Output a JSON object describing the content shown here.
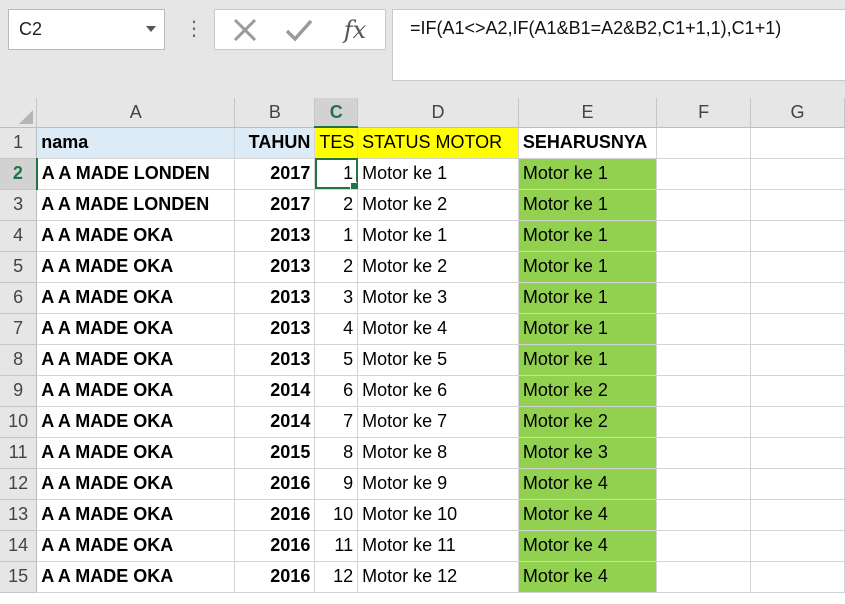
{
  "name_box": {
    "value": "C2"
  },
  "formula_bar": {
    "fx_label": "fx",
    "formula": "=IF(A1<>A2,IF(A1&B1=A2&B2,C1+1,1),C1+1)"
  },
  "columns": [
    "A",
    "B",
    "C",
    "D",
    "E",
    "F",
    "G"
  ],
  "selected_column": "C",
  "selected_row": "2",
  "header_row": {
    "row_number": "1",
    "cells": [
      "nama",
      "TAHUN",
      "TES",
      "STATUS MOTOR",
      "SEHARUSNYA",
      "",
      ""
    ]
  },
  "rows": [
    {
      "row_number": "2",
      "nama": "A A MADE LONDEN",
      "tahun": "2017",
      "tes": "1",
      "status": "Motor ke 1",
      "seharusnya": "Motor ke 1"
    },
    {
      "row_number": "3",
      "nama": "A A MADE LONDEN",
      "tahun": "2017",
      "tes": "2",
      "status": "Motor ke 2",
      "seharusnya": "Motor ke 1"
    },
    {
      "row_number": "4",
      "nama": "A A MADE OKA",
      "tahun": "2013",
      "tes": "1",
      "status": "Motor ke 1",
      "seharusnya": "Motor ke 1"
    },
    {
      "row_number": "5",
      "nama": "A A MADE OKA",
      "tahun": "2013",
      "tes": "2",
      "status": "Motor ke 2",
      "seharusnya": "Motor ke 1"
    },
    {
      "row_number": "6",
      "nama": "A A MADE OKA",
      "tahun": "2013",
      "tes": "3",
      "status": "Motor ke 3",
      "seharusnya": "Motor ke 1"
    },
    {
      "row_number": "7",
      "nama": "A A MADE OKA",
      "tahun": "2013",
      "tes": "4",
      "status": "Motor ke 4",
      "seharusnya": "Motor ke 1"
    },
    {
      "row_number": "8",
      "nama": "A A MADE OKA",
      "tahun": "2013",
      "tes": "5",
      "status": "Motor ke 5",
      "seharusnya": "Motor ke 1"
    },
    {
      "row_number": "9",
      "nama": "A A MADE OKA",
      "tahun": "2014",
      "tes": "6",
      "status": "Motor ke 6",
      "seharusnya": "Motor ke 2"
    },
    {
      "row_number": "10",
      "nama": "A A MADE OKA",
      "tahun": "2014",
      "tes": "7",
      "status": "Motor ke 7",
      "seharusnya": "Motor ke 2"
    },
    {
      "row_number": "11",
      "nama": "A A MADE OKA",
      "tahun": "2015",
      "tes": "8",
      "status": "Motor ke 8",
      "seharusnya": "Motor ke 3"
    },
    {
      "row_number": "12",
      "nama": "A A MADE OKA",
      "tahun": "2016",
      "tes": "9",
      "status": "Motor ke 9",
      "seharusnya": "Motor ke 4"
    },
    {
      "row_number": "13",
      "nama": "A A MADE OKA",
      "tahun": "2016",
      "tes": "10",
      "status": "Motor ke 10",
      "seharusnya": "Motor ke 4"
    },
    {
      "row_number": "14",
      "nama": "A A MADE OKA",
      "tahun": "2016",
      "tes": "11",
      "status": "Motor ke 11",
      "seharusnya": "Motor ke 4"
    },
    {
      "row_number": "15",
      "nama": "A A MADE OKA",
      "tahun": "2016",
      "tes": "12",
      "status": "Motor ke 12",
      "seharusnya": "Motor ke 4"
    }
  ],
  "colors": {
    "header_blue": "#ddebf7",
    "header_yellow": "#ffff00",
    "result_green": "#92d050",
    "selection_green": "#217346"
  }
}
